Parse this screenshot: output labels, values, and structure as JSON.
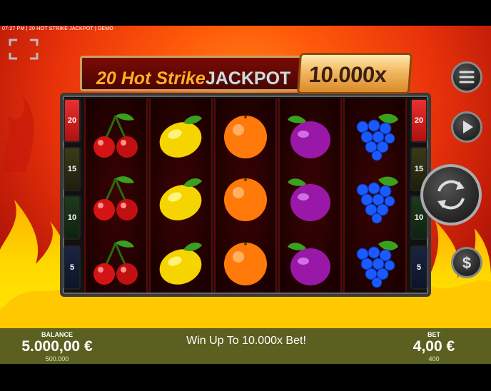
{
  "status_bar": {
    "text": "07:27 PM | 20 HOT STRIKE JACKPOT | DEMO"
  },
  "title": {
    "part_hot": "20 Hot Strike",
    "part_jackpot": "JACKPOT",
    "multiplier": "10.000x"
  },
  "paylines": {
    "left": [
      "20",
      "15",
      "10",
      "5"
    ],
    "right": [
      "20",
      "15",
      "10",
      "5"
    ]
  },
  "reels": [
    {
      "symbols": [
        "cherry-icon",
        "cherry-icon",
        "cherry-icon"
      ]
    },
    {
      "symbols": [
        "lemon-icon",
        "lemon-icon",
        "lemon-icon"
      ]
    },
    {
      "symbols": [
        "orange-icon",
        "orange-icon",
        "orange-icon"
      ]
    },
    {
      "symbols": [
        "plum-icon",
        "plum-icon",
        "plum-icon"
      ]
    },
    {
      "symbols": [
        "grapes-icon",
        "grapes-icon",
        "grapes-icon"
      ]
    }
  ],
  "controls": {
    "menu": "menu-icon",
    "autoplay": "play-icon",
    "spin": "spin-icon",
    "currency": "dollar-icon",
    "fullscreen": "fullscreen-icon"
  },
  "footer": {
    "balance_label": "BALANCE",
    "balance_value": "5.000,00 €",
    "balance_credits": "500.000",
    "message": "Win Up To 10.000x Bet!",
    "bet_label": "BET",
    "bet_value": "4,00 €",
    "bet_credits": "400"
  },
  "colors": {
    "accent_gold": "#f2b860",
    "footer_bg": "#5b6020",
    "payline_20": "#e83030"
  }
}
